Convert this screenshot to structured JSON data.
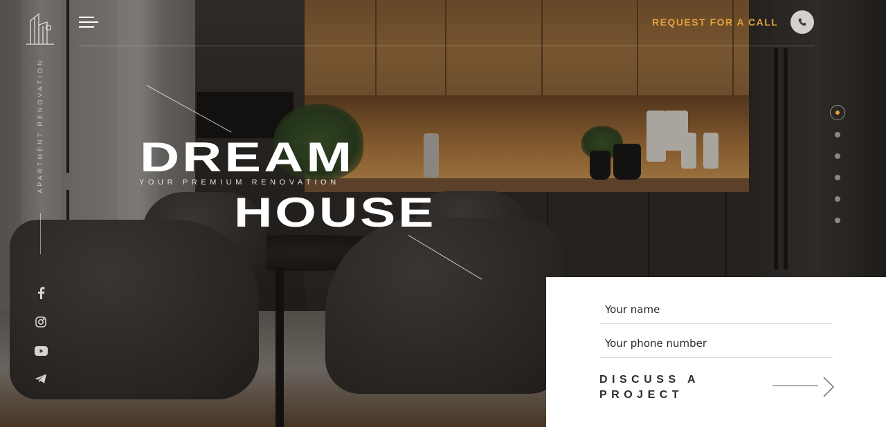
{
  "brand": {
    "vertical_text": "APARTMENT RENOVATION",
    "logo_icon": "building-logo-icon"
  },
  "header": {
    "menu_icon": "hamburger-menu-icon",
    "cta_label": "REQUEST FOR A CALL",
    "phone_icon": "phone-icon",
    "accent_color": "#e5a23a"
  },
  "hero": {
    "title_line1": "DREAM",
    "subtitle": "YOUR PREMIUM RENOVATION",
    "title_line2": "HOUSE"
  },
  "social": [
    {
      "name": "facebook",
      "icon": "facebook-icon"
    },
    {
      "name": "instagram",
      "icon": "instagram-icon"
    },
    {
      "name": "youtube",
      "icon": "youtube-icon"
    },
    {
      "name": "telegram",
      "icon": "telegram-icon"
    }
  ],
  "slider": {
    "count": 6,
    "active_index": 0
  },
  "form": {
    "name_placeholder": "Your name",
    "phone_placeholder": "Your phone number",
    "submit_label": "DISCUSS A PROJECT",
    "submit_icon": "arrow-right-icon"
  }
}
